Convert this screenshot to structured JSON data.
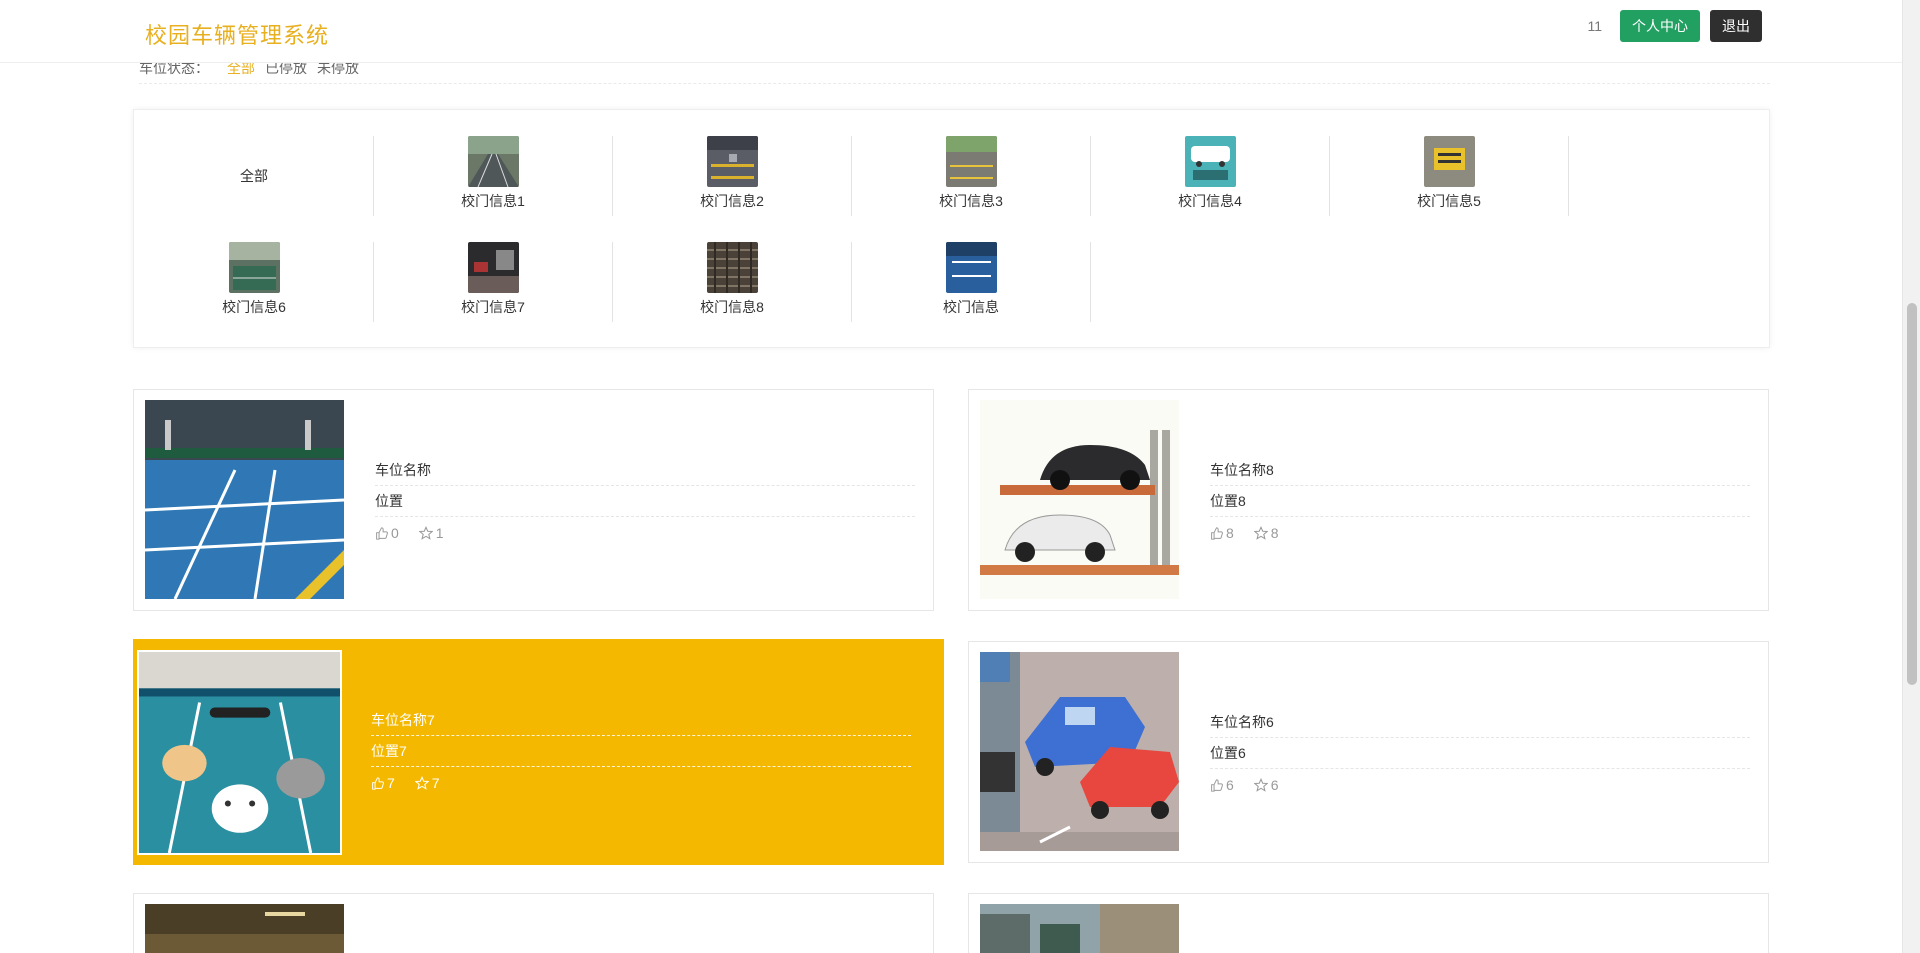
{
  "header": {
    "logo": "校园车辆管理系统",
    "username": "11",
    "profile_btn": "个人中心",
    "logout_btn": "退出"
  },
  "status_filter": {
    "label": "车位状态：",
    "options": [
      "全部",
      "已停放",
      "未停放"
    ]
  },
  "categories": [
    {
      "label": "全部"
    },
    {
      "label": "校门信息1"
    },
    {
      "label": "校门信息2"
    },
    {
      "label": "校门信息3"
    },
    {
      "label": "校门信息4"
    },
    {
      "label": "校门信息5"
    },
    {
      "label": "校门信息6"
    },
    {
      "label": "校门信息7"
    },
    {
      "label": "校门信息8"
    },
    {
      "label": "校门信息"
    }
  ],
  "cards": [
    {
      "name": "车位名称",
      "position": "位置",
      "likes": "0",
      "favorites": "1"
    },
    {
      "name": "车位名称8",
      "position": "位置8",
      "likes": "8",
      "favorites": "8"
    },
    {
      "name": "车位名称7",
      "position": "位置7",
      "likes": "7",
      "favorites": "7"
    },
    {
      "name": "车位名称6",
      "position": "位置6",
      "likes": "6",
      "favorites": "6"
    }
  ],
  "colors": {
    "accent": "#e8b01f",
    "highlight": "#f4b800",
    "profile_btn": "#22a062",
    "logout_btn": "#2f2f2f"
  },
  "icons": [
    "thumbs-up-icon",
    "star-icon"
  ]
}
